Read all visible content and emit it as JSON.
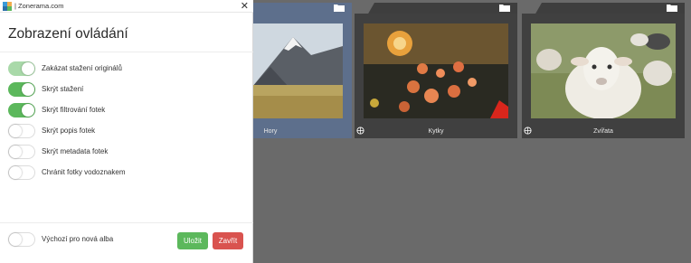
{
  "window": {
    "title": "| Zonerama.com"
  },
  "panel": {
    "heading": "Zobrazení ovládání",
    "options": [
      {
        "label": "Zakázat stažení originálů",
        "state": "on-disabled"
      },
      {
        "label": "Skrýt stažení",
        "state": "on"
      },
      {
        "label": "Skrýt filtrování fotek",
        "state": "on"
      },
      {
        "label": "Skrýt popis fotek",
        "state": "off"
      },
      {
        "label": "Skrýt metadata fotek",
        "state": "off"
      },
      {
        "label": "Chránit fotky vodoznakem",
        "state": "off"
      }
    ],
    "default_option": {
      "label": "Výchozí pro nová alba",
      "state": "off"
    },
    "save_label": "Uložit",
    "close_label": "Zavřít"
  },
  "albums": [
    {
      "caption": "Hory",
      "selected": true
    },
    {
      "caption": "Kytky",
      "selected": false
    },
    {
      "caption": "Zvířata",
      "selected": false
    }
  ],
  "colors": {
    "toggle_on": "#5cb85c",
    "save": "#5cb85c",
    "close": "#d9534f",
    "selected_album": "#5d6f8c"
  }
}
